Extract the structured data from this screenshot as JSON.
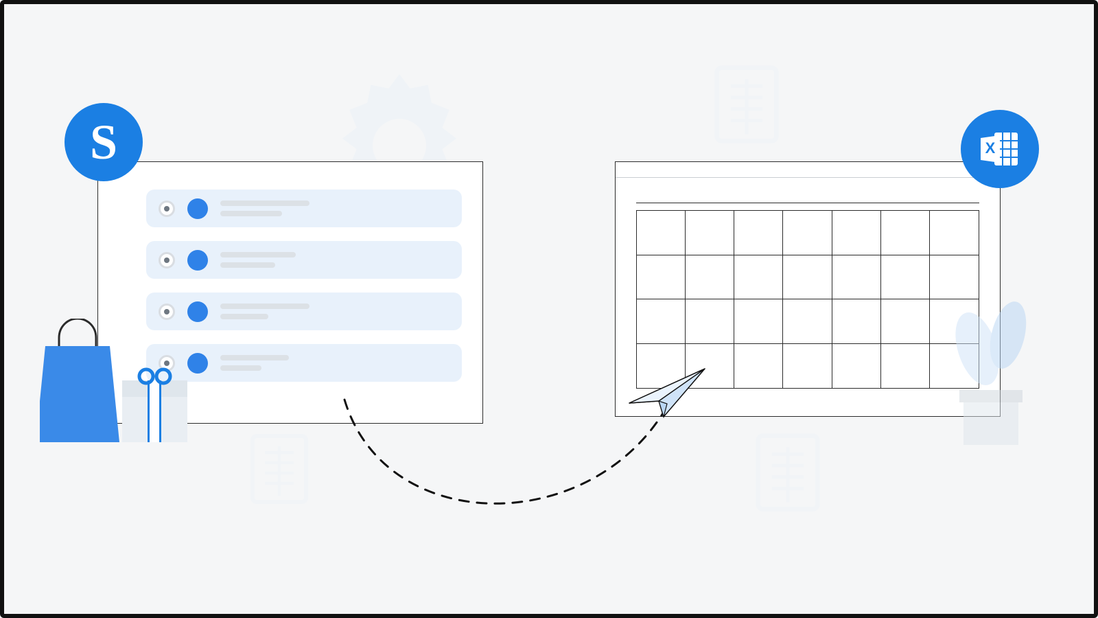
{
  "badges": {
    "source_letter": "S",
    "source_name": "shopify-logo",
    "target_name": "excel-logo"
  },
  "left_panel": {
    "rows": 4
  },
  "right_panel": {
    "grid": {
      "cols": 7,
      "rows": 4
    }
  },
  "icons": {
    "gear": "gear-icon",
    "excel_watermark": "excel-watermark-icon",
    "shopping_bag": "shopping-bag-icon",
    "gift": "gift-box-icon",
    "paper_plane": "paper-plane-icon",
    "plant": "potted-plant-icon",
    "arrow": "dashed-arrow-icon"
  },
  "colors": {
    "accent": "#1b7fe3",
    "accent_alt": "#2f82e8",
    "row_bg": "#e8f1fb",
    "muted_bar": "#dce1e6",
    "outline": "#2b2b2b",
    "page_bg": "#f5f6f7"
  }
}
